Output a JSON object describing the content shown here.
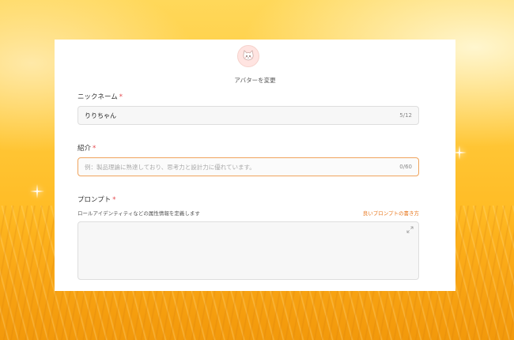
{
  "avatar": {
    "icon": "cat-avatar-icon",
    "change_label": "アバターを変更"
  },
  "nickname": {
    "label": "ニックネーム",
    "required_mark": "*",
    "value": "りりちゃん",
    "count": "5/12"
  },
  "intro": {
    "label": "紹介",
    "required_mark": "*",
    "placeholder": "例：製品理論に熟達しており、思考力と設計力に優れています。",
    "count": "0/60"
  },
  "prompt": {
    "label": "プロンプト",
    "required_mark": "*",
    "hint": "ロールアイデンティティなどの属性情報を定義します",
    "guide_link": "良いプロンプトの書き方",
    "value": "",
    "expand_icon": "expand-icon"
  },
  "colors": {
    "accent": "#e8781f",
    "required": "#e5484d",
    "active_border": "#f0a45d"
  }
}
